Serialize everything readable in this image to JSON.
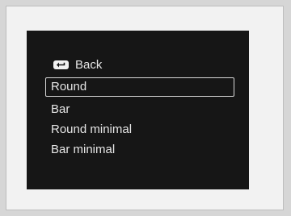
{
  "menu": {
    "back_label": "Back",
    "back_icon": "return-arrow-icon",
    "selected_index": 0,
    "items": [
      {
        "label": "Round"
      },
      {
        "label": "Bar"
      },
      {
        "label": "Round minimal"
      },
      {
        "label": "Bar minimal"
      }
    ]
  },
  "colors": {
    "screen_background": "#161616",
    "text": "#e6e6e6",
    "selection_border": "#d8d8d8",
    "outer_background": "#f2f2f2"
  }
}
